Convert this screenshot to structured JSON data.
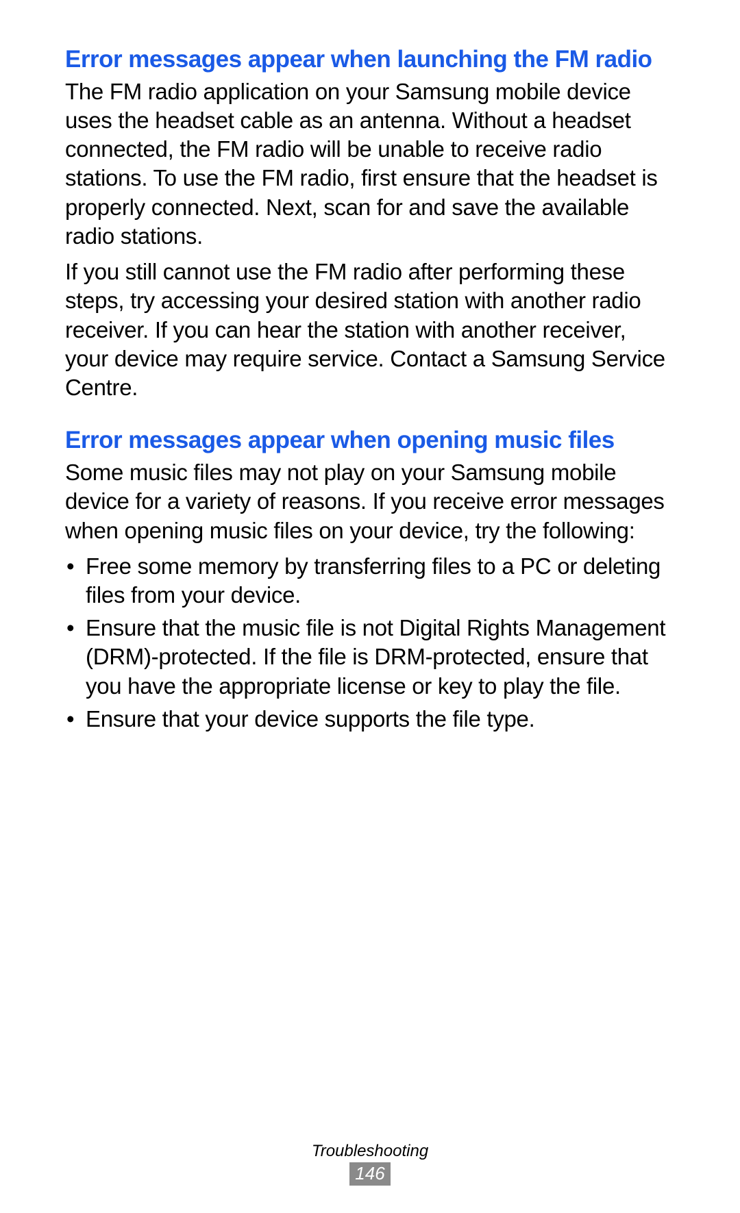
{
  "sections": [
    {
      "heading": "Error messages appear when launching the FM radio",
      "paragraphs": [
        "The FM radio application on your Samsung mobile device uses the headset cable as an antenna. Without a headset connected, the FM radio will be unable to receive radio stations. To use the FM radio, first ensure that the headset is properly connected. Next, scan for and save the available radio stations.",
        "If you still cannot use the FM radio after performing these steps, try accessing your desired station with another radio receiver. If you can hear the station with another receiver, your device may require service. Contact a Samsung Service Centre."
      ],
      "bullets": []
    },
    {
      "heading": "Error messages appear when opening music files",
      "paragraphs": [
        "Some music files may not play on your Samsung mobile device for a variety of reasons. If you receive error messages when opening music files on your device, try the following:"
      ],
      "bullets": [
        "Free some memory by transferring files to a PC or deleting files from your device.",
        "Ensure that the music file is not Digital Rights Management (DRM)-protected. If the file is DRM-protected, ensure that you have the appropriate license or key to play the file.",
        "Ensure that your device supports the file type."
      ]
    }
  ],
  "footer": {
    "label": "Troubleshooting",
    "page_number": "146"
  }
}
